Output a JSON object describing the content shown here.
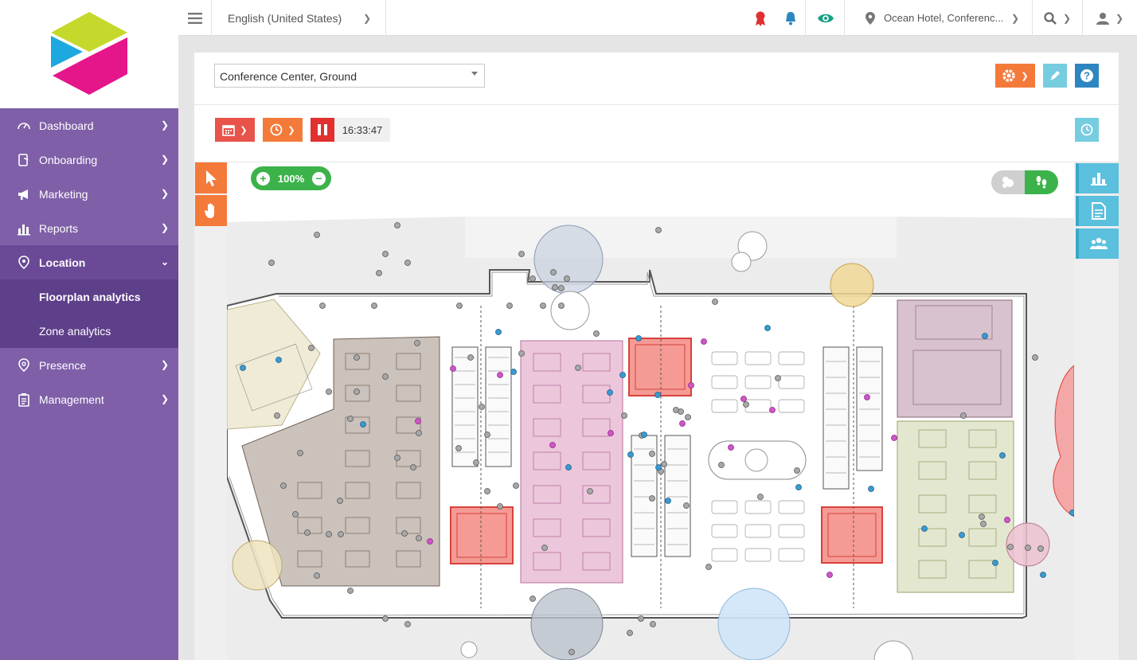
{
  "sidebar": {
    "items": [
      {
        "label": "Dashboard"
      },
      {
        "label": "Onboarding"
      },
      {
        "label": "Marketing"
      },
      {
        "label": "Reports"
      },
      {
        "label": "Location"
      },
      {
        "label": "Presence"
      },
      {
        "label": "Management"
      }
    ],
    "location_sub": [
      {
        "label": "Floorplan analytics"
      },
      {
        "label": "Zone analytics"
      }
    ]
  },
  "topbar": {
    "language": "English (United States)",
    "venue": "Ocean Hotel, Conferenc..."
  },
  "panel": {
    "floor_selector": "Conference Center, Ground",
    "playback_time": "16:33:47",
    "zoom_level": "100%"
  },
  "colors": {
    "sidebar_bg": "#7f5fa8",
    "sidebar_active": "#6a4a96",
    "sidebar_sub": "#5e3f8a",
    "orange": "#f47a3a",
    "red": "#e8534a",
    "teal": "#5bc0de",
    "green": "#3cb34a",
    "blue": "#2e86c1"
  }
}
